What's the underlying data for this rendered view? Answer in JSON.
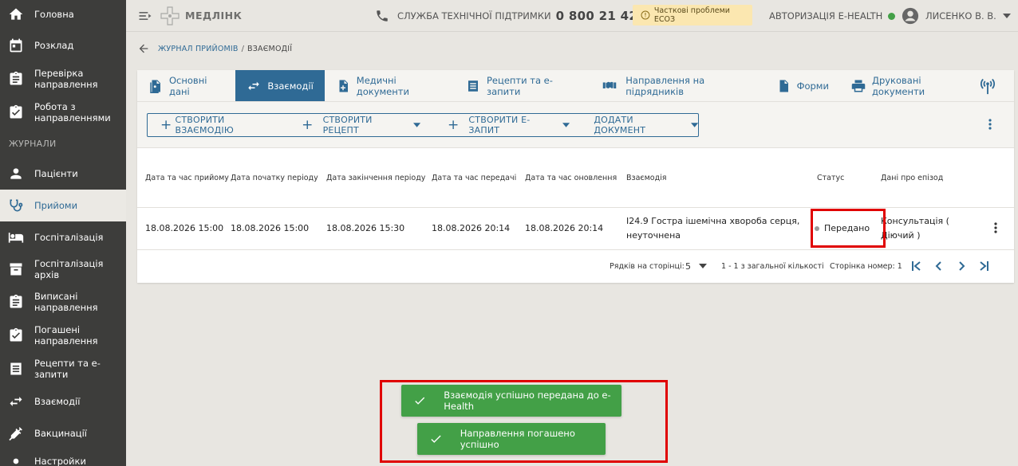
{
  "sidebar": {
    "items": [
      {
        "label": "Головна",
        "icon": "home-icon"
      },
      {
        "label": "Розклад",
        "icon": "calendar-icon"
      },
      {
        "label": "Перевірка направлення",
        "icon": "clipboard-icon"
      },
      {
        "label": "Робота з направленнями",
        "icon": "clipboard-check-icon"
      }
    ],
    "section_label": "ЖУРНАЛИ",
    "journal_items": [
      {
        "label": "Пацієнти",
        "icon": "person-icon"
      },
      {
        "label": "Прийоми",
        "icon": "stethoscope-icon",
        "active": true
      },
      {
        "label": "Госпіталізація",
        "icon": "bed-icon"
      },
      {
        "label": "Госпіталізація архів",
        "icon": "archive-icon"
      },
      {
        "label": "Виписані направлення",
        "icon": "clipboard-icon"
      },
      {
        "label": "Погашені направлення",
        "icon": "clipboard-check-icon"
      },
      {
        "label": "Рецепти та е-запити",
        "icon": "list-icon"
      },
      {
        "label": "Взаємодії",
        "icon": "swap-icon"
      },
      {
        "label": "Вакцинації",
        "icon": "syringe-icon"
      },
      {
        "label": "Настройки",
        "icon": "settings-icon"
      }
    ]
  },
  "topbar": {
    "brand": "МЕДЛІНК",
    "support_label": "СЛУЖБА ТЕХНІЧНОЇ ПІДТРИМКИ",
    "support_phone": "0 800 21 42 00",
    "warning": "Часткові проблеми ЕСОЗ",
    "auth_label": "АВТОРИЗАЦІЯ E-HEALTH",
    "auth_status_color": "#43a047",
    "user_name": "ЛИСЕНКО В. В."
  },
  "breadcrumb": {
    "parent": "ЖУРНАЛ ПРИЙОМІВ",
    "separator": "/",
    "current": "ВЗАЄМОДІЇ"
  },
  "tabs": [
    {
      "label": "Основні дані",
      "icon": "person-doc-icon"
    },
    {
      "label": "Взаємодії",
      "icon": "swap-icon",
      "active": true
    },
    {
      "label": "Медичні документи",
      "icon": "medical-doc-icon"
    },
    {
      "label": "Рецепти та е-запити",
      "icon": "list-icon"
    },
    {
      "label": "Направлення на підрядників",
      "icon": "handshake-icon"
    },
    {
      "label": "Форми",
      "icon": "doc-icon"
    },
    {
      "label": "Друковані документи",
      "icon": "printer-icon"
    }
  ],
  "actions": {
    "create_interaction": "СТВОРИТИ ВЗАЄМОДІЮ",
    "create_recipe": "СТВОРИТИ РЕЦЕПТ",
    "create_request": "СТВОРИТИ Е-ЗАПИТ",
    "add_document": "ДОДАТИ ДОКУМЕНТ"
  },
  "table": {
    "columns": [
      "Дата та час прийому",
      "Дата початку періоду",
      "Дата закінчення періоду",
      "Дата та час передачі",
      "Дата та час оновлення",
      "Взаємодія",
      "Статус",
      "Дані про епізод"
    ],
    "rows": [
      {
        "visit": "18.08.2026 15:00",
        "start": "18.08.2026 15:00",
        "end": "18.08.2026 15:30",
        "sent": "18.08.2026 20:14",
        "updated": "18.08.2026 20:14",
        "interaction": "I24.9 Гостра ішемічна хвороба серця, неуточнена",
        "status": "Передано",
        "episode": "Консультація ( Діючий )"
      }
    ]
  },
  "pager": {
    "rows_label": "Рядків на сторінці:",
    "rows_value": "5",
    "range": "1 - 1 з загальної кількості",
    "page_label": "Сторінка номер: 1"
  },
  "toasts": [
    "Взаємодія успішно передана до e-Health",
    "Направлення погашено успішно"
  ],
  "colors": {
    "primary": "#2f6a95",
    "sidebar": "#3d3d3b",
    "success": "#43a047",
    "highlight": "#e00000",
    "warning_bg": "#fbe7b0"
  }
}
